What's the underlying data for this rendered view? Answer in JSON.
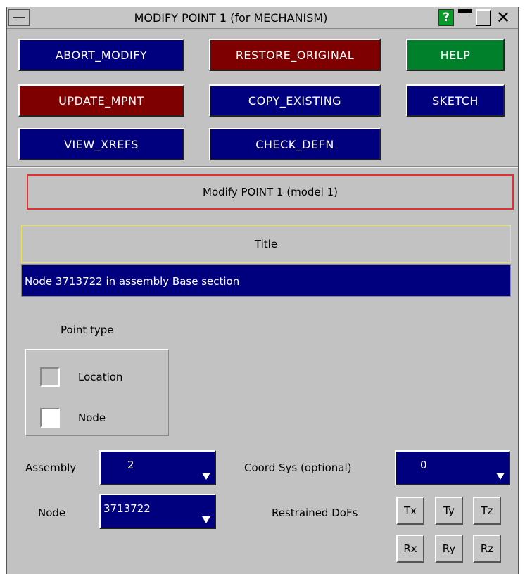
{
  "window": {
    "title": "MODIFY POINT 1 (for MECHANISM)",
    "help_glyph": "?",
    "close_glyph": "✕"
  },
  "buttons": {
    "abort_modify": "ABORT_MODIFY",
    "restore_original": "RESTORE_ORIGINAL",
    "help": "HELP",
    "update_mpnt": "UPDATE_MPNT",
    "copy_existing": "COPY_EXISTING",
    "sketch": "SKETCH",
    "view_xrefs": "VIEW_XREFS",
    "check_defn": "CHECK_DEFN"
  },
  "header": {
    "modify_label": "Modify POINT 1 (model 1)"
  },
  "title_section": {
    "label": "Title",
    "value": "Node  3713722 in assembly Base section"
  },
  "point_type": {
    "label": "Point type",
    "options": [
      {
        "label": "Location",
        "checked": false
      },
      {
        "label": "Node",
        "checked": true
      }
    ]
  },
  "fields": {
    "assembly_label": "Assembly",
    "assembly_value": "2",
    "node_label": "Node",
    "node_value": "3713722",
    "coord_sys_label": "Coord Sys (optional)",
    "coord_sys_value": "0",
    "restrained_label": "Restrained DoFs"
  },
  "dofs": [
    "Tx",
    "Ty",
    "Tz",
    "Rx",
    "Ry",
    "Rz"
  ],
  "colors": {
    "panel_bg": "#c2c2c2",
    "blue": "#00007f",
    "red": "#7f0000",
    "green": "#00802a",
    "modify_border": "#e03030",
    "title_border": "#e8e060"
  }
}
